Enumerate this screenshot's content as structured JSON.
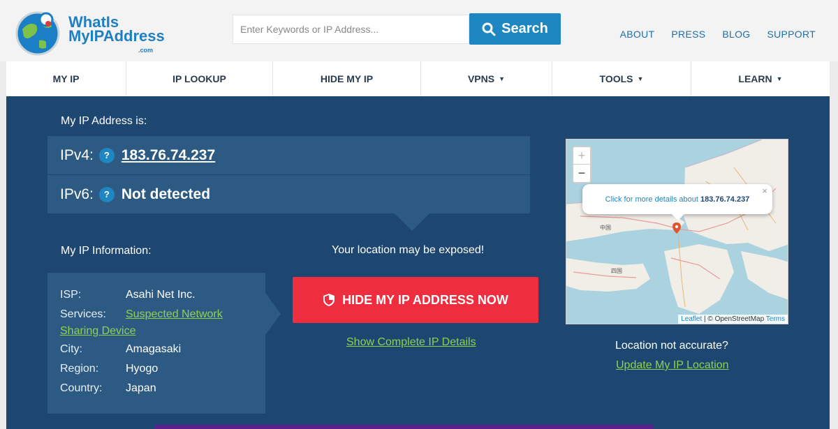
{
  "header": {
    "logo": {
      "line1": "WhatIs",
      "line2": "MyIPAddress",
      "suffix": ".com"
    },
    "search": {
      "placeholder": "Enter Keywords or IP Address...",
      "button_label": "Search"
    },
    "links": [
      "ABOUT",
      "PRESS",
      "BLOG",
      "SUPPORT"
    ]
  },
  "nav": {
    "items": [
      {
        "label": "MY IP",
        "dropdown": false
      },
      {
        "label": "IP LOOKUP",
        "dropdown": false
      },
      {
        "label": "HIDE MY IP",
        "dropdown": false
      },
      {
        "label": "VPNS",
        "dropdown": true
      },
      {
        "label": "TOOLS",
        "dropdown": true
      },
      {
        "label": "LEARN",
        "dropdown": true
      }
    ],
    "caret": "▼"
  },
  "main": {
    "ip_heading": "My IP Address is:",
    "ipv4_label": "IPv4:",
    "ipv4_value": "183.76.74.237",
    "ipv6_label": "IPv6:",
    "ipv6_value": "Not detected",
    "help_mark": "?",
    "info_heading": "My IP Information:",
    "info": {
      "isp_label": "ISP:",
      "isp_value": "Asahi Net Inc.",
      "services_label": "Services:",
      "services_link_1": "Suspected Network",
      "services_link_2": "Sharing Device",
      "city_label": "City:",
      "city_value": "Amagasaki",
      "region_label": "Region:",
      "region_value": "Hyogo",
      "country_label": "Country:",
      "country_value": "Japan"
    },
    "exposed_text": "Your location may be exposed!",
    "hide_button": "HIDE MY IP ADDRESS NOW",
    "show_details_link": "Show Complete IP Details",
    "map": {
      "zoom_in": "+",
      "zoom_out": "−",
      "popup_text": "Click for more details about",
      "popup_ip": "183.76.74.237",
      "popup_close": "×",
      "attribution_leaflet": "Leaflet",
      "attribution_sep": " | © OpenStreetMap ",
      "attribution_terms": "Terms",
      "label_chugoku": "中国",
      "label_shikoku": "四国"
    },
    "location_question": "Location not accurate?",
    "update_link": "Update My IP Location"
  },
  "colors": {
    "panel": "#1d4670",
    "box": "#2d5a83",
    "accent_blue": "#1e87c1",
    "hide_red": "#ee2d3e",
    "link_green": "#8fd14f"
  }
}
